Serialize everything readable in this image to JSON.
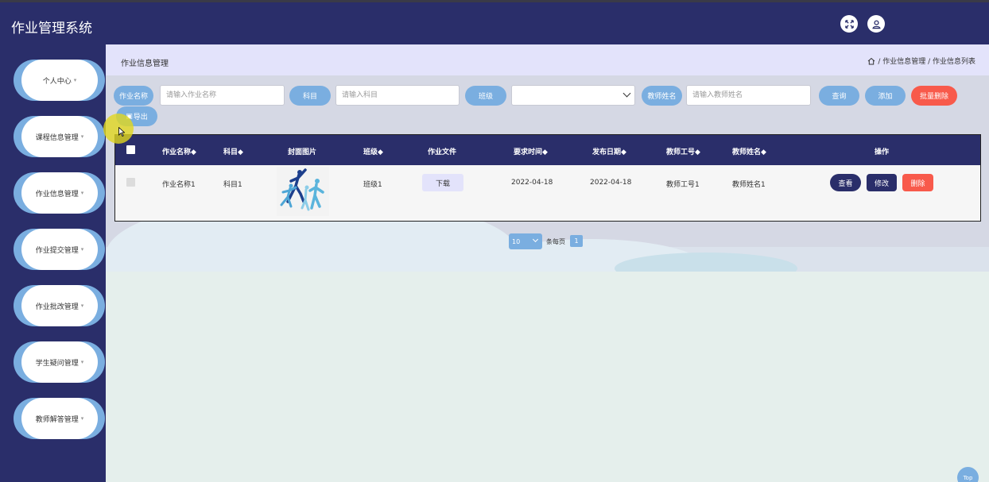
{
  "app": {
    "title": "作业管理系统"
  },
  "header": {
    "fullscreen_icon": "fullscreen-icon",
    "user_icon": "user-icon"
  },
  "sidebar": {
    "items": [
      {
        "label": "个人中心"
      },
      {
        "label": "课程信息管理"
      },
      {
        "label": "作业信息管理"
      },
      {
        "label": "作业提交管理"
      },
      {
        "label": "作业批改管理"
      },
      {
        "label": "学生疑问管理"
      },
      {
        "label": "教师解答管理"
      }
    ]
  },
  "page": {
    "title": "作业信息管理",
    "breadcrumb": {
      "home_icon": "home-icon",
      "text": "/ 作业信息管理 / 作业信息列表"
    }
  },
  "filters": {
    "name_label": "作业名称",
    "name_placeholder": "请输入作业名称",
    "subject_label": "科目",
    "subject_placeholder": "请输入科目",
    "class_label": "班级",
    "class_value": "",
    "teacher_label": "教师姓名",
    "teacher_placeholder": "请输入教师姓名"
  },
  "actions": {
    "query": "查询",
    "add": "添加",
    "batch_delete": "批量删除",
    "export": "导出"
  },
  "table": {
    "headers": [
      "作业名称◆",
      "科目◆",
      "封面图片",
      "班级◆",
      "作业文件",
      "要求时间◆",
      "发布日期◆",
      "教师工号◆",
      "教师姓名◆",
      "操作"
    ],
    "rows": [
      {
        "name": "作业名称1",
        "subject": "科目1",
        "class": "班级1",
        "file_button": "下载",
        "due_time": "2022-04-18",
        "publish_date": "2022-04-18",
        "teacher_id": "教师工号1",
        "teacher_name": "教师姓名1",
        "view": "查看",
        "edit": "修改",
        "delete": "删除"
      }
    ]
  },
  "pagination": {
    "page_size": "10",
    "label": "条每页",
    "current_page": "1"
  },
  "back_to_top": "Top",
  "colors": {
    "nav": "#2a2e6a",
    "accent": "#7aaee0",
    "danger": "#f85a4b",
    "lavender": "#e3e3fb"
  }
}
